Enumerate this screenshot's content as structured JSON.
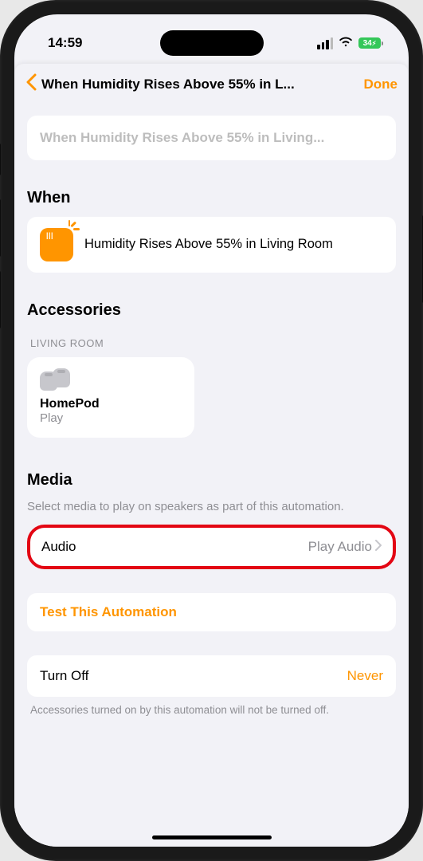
{
  "status_bar": {
    "time": "14:59",
    "battery": "34"
  },
  "nav": {
    "title": "When Humidity Rises Above 55% in L...",
    "done": "Done"
  },
  "name_field": {
    "placeholder": "When Humidity Rises Above 55% in Living..."
  },
  "when": {
    "header": "When",
    "condition": "Humidity Rises Above 55% in Living Room"
  },
  "accessories": {
    "header": "Accessories",
    "room": "LIVING ROOM",
    "device_name": "HomePod",
    "device_action": "Play"
  },
  "media": {
    "header": "Media",
    "subtext": "Select media to play on speakers as part of this automation.",
    "row_label": "Audio",
    "row_value": "Play Audio"
  },
  "test": {
    "label": "Test This Automation"
  },
  "turn_off": {
    "label": "Turn Off",
    "value": "Never",
    "footnote": "Accessories turned on by this automation will not be turned off."
  }
}
